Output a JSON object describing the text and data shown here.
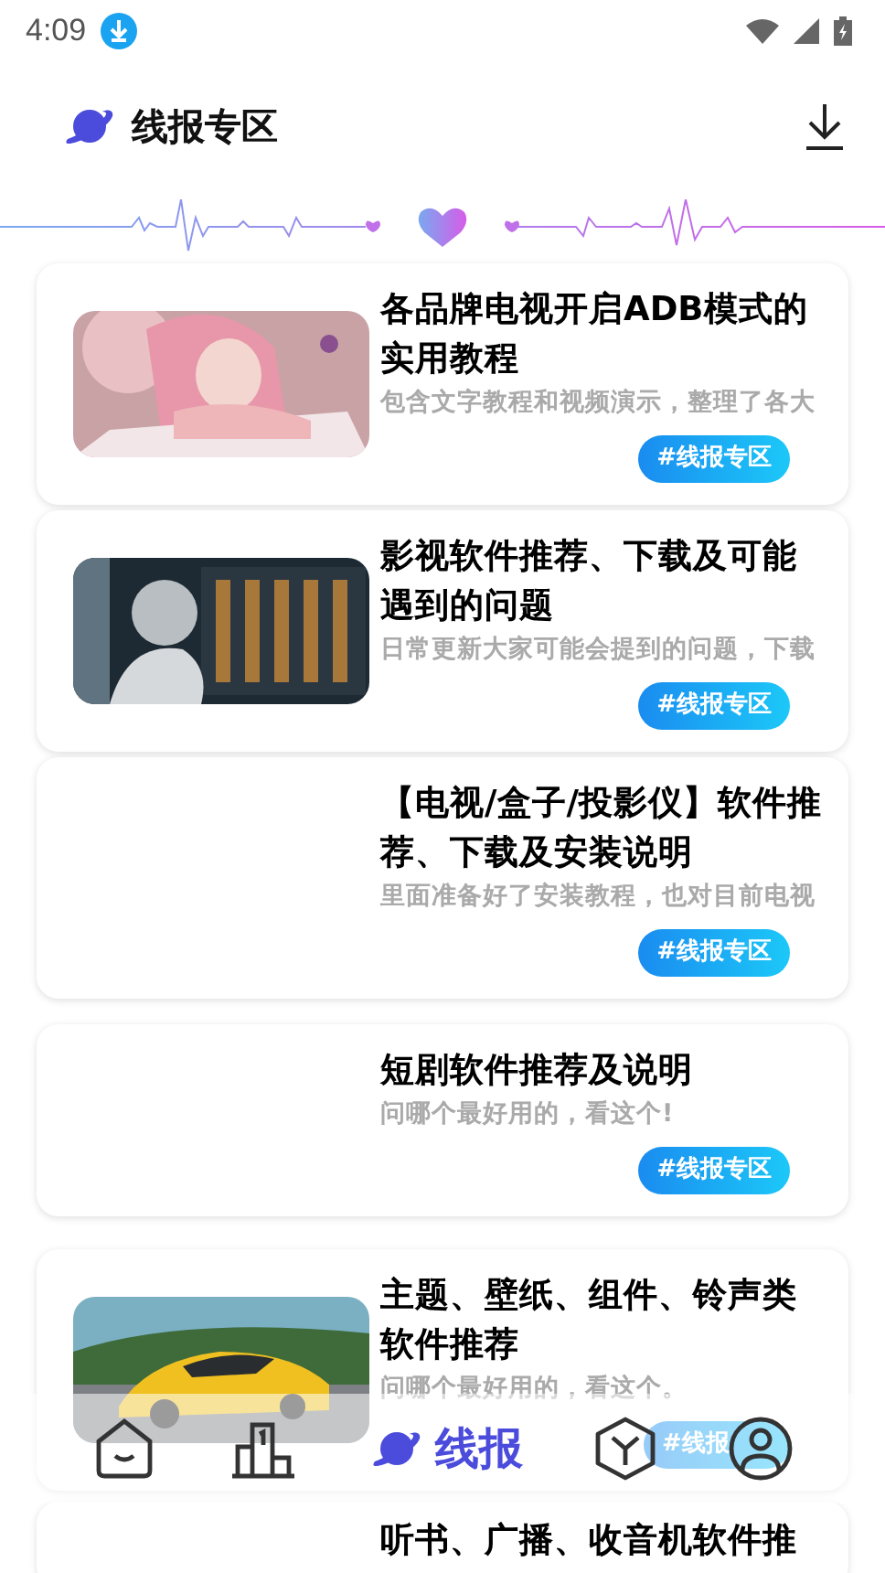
{
  "status_bar": {
    "time": "4:09"
  },
  "header": {
    "title": "线报专区"
  },
  "posts": [
    {
      "has_picture": true,
      "title": "各品牌电视开启ADB模式的实用教程",
      "description": "包含文字教程和视频演示，整理了各大",
      "tag": "#线报专区"
    },
    {
      "has_picture": true,
      "title": "影视软件推荐、下载及可能遇到的问题",
      "description": "日常更新大家可能会提到的问题，下载",
      "tag": "#线报专区"
    },
    {
      "has_picture": false,
      "title": "【电视/盒子/投影仪】软件推荐、下载及安装说明",
      "description": "里面准备好了安装教程，也对目前电视",
      "tag": "#线报专区"
    },
    {
      "has_picture": false,
      "title": "短剧软件推荐及说明",
      "description": "问哪个最好用的，看这个!",
      "tag": "#线报专区"
    },
    {
      "has_picture": true,
      "title": "主题、壁纸、组件、铃声类软件推荐",
      "description": "问哪个最好用的，看这个。",
      "tag": "#线报"
    },
    {
      "title": "听书、广播、收音机软件推"
    }
  ],
  "nav": [
    {
      "kind": "home",
      "selected": false
    },
    {
      "kind": "ranking",
      "selected": false
    },
    {
      "kind": "planet",
      "label": "线报",
      "selected": true
    },
    {
      "kind": "cube",
      "selected": false
    },
    {
      "kind": "profile",
      "selected": false
    }
  ]
}
